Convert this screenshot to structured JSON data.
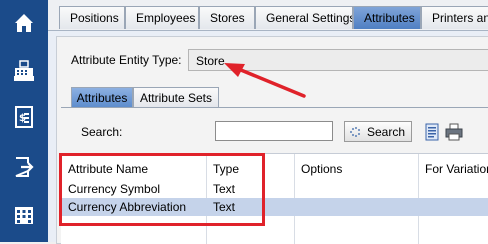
{
  "sidebar": {
    "items": [
      {
        "icon": "home-icon"
      },
      {
        "icon": "cash-register-icon"
      },
      {
        "icon": "receipt-icon"
      },
      {
        "icon": "logout-icon"
      },
      {
        "icon": "grid-building-icon"
      }
    ]
  },
  "top_tabs": [
    "Positions",
    "Employees",
    "Stores",
    "General Settings",
    "Attributes",
    "Printers and"
  ],
  "active_top_tab": "Attributes",
  "entity": {
    "label": "Attribute Entity Type:",
    "value": "Store"
  },
  "sub_tabs": [
    "Attributes",
    "Attribute Sets"
  ],
  "active_sub_tab": "Attributes",
  "search": {
    "label": "Search:",
    "value": "",
    "button_label": "Search"
  },
  "grid": {
    "columns": [
      "Attribute Name",
      "Type",
      "Options",
      "For Variation"
    ],
    "rows": [
      {
        "name": "Currency Symbol",
        "type": "Text",
        "options": "",
        "variation": ""
      },
      {
        "name": "Currency Abbreviation",
        "type": "Text",
        "options": "",
        "variation": ""
      }
    ],
    "selected_row": 1
  },
  "colors": {
    "sidebar": "#1b4b8a",
    "annotation": "#e0222a",
    "selection": "#c5d3ea"
  }
}
